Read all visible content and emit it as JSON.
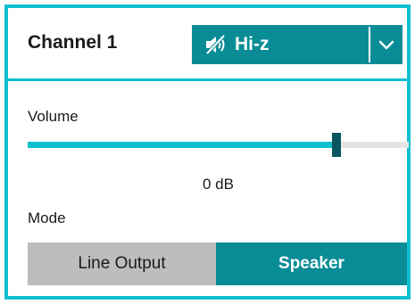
{
  "channel": {
    "title": "Channel 1"
  },
  "output_select": {
    "selected": "Hi-z",
    "icon": "speaker-muted-icon",
    "chevron": "chevron-down-icon"
  },
  "volume": {
    "label": "Volume",
    "value_text": "0 dB",
    "level_fraction": 0.81
  },
  "mode": {
    "label": "Mode",
    "options": [
      "Line Output",
      "Speaker"
    ],
    "selected": "Speaker"
  },
  "colors": {
    "accent": "#10bfcf",
    "active": "#0a8c97",
    "thumb": "#0a5560",
    "inactive": "#bdbdbd"
  }
}
